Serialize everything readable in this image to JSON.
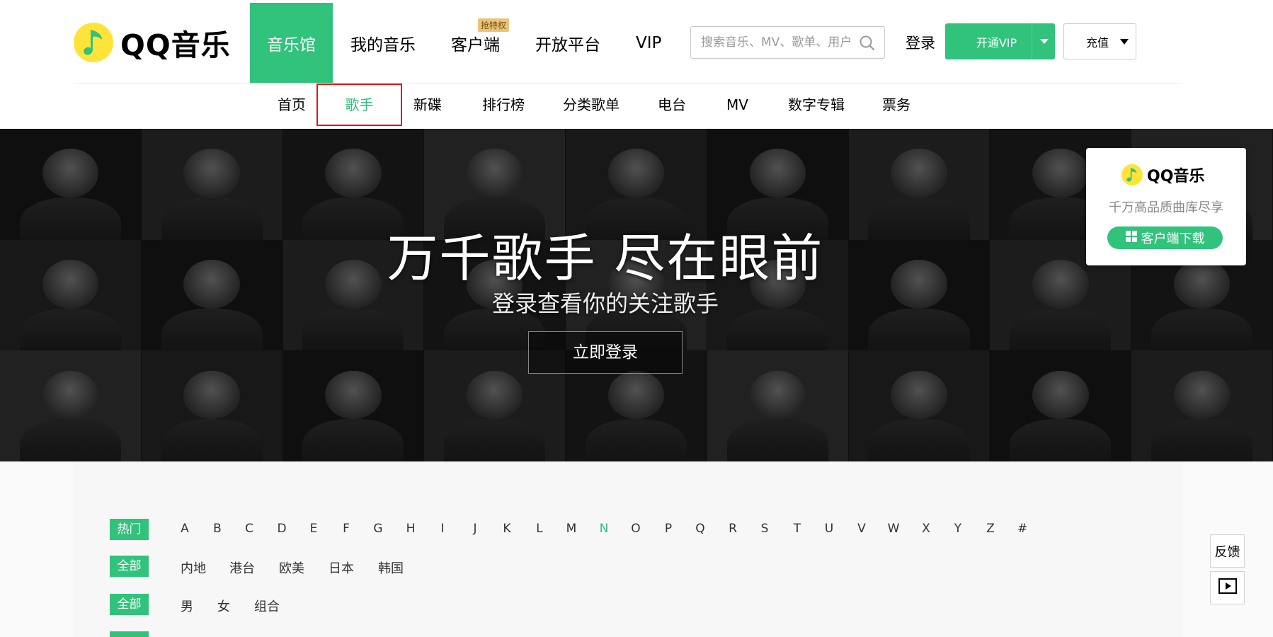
{
  "header": {
    "logo_text": "QQ音乐",
    "nav": [
      {
        "label": "音乐馆",
        "active": true
      },
      {
        "label": "我的音乐"
      },
      {
        "label": "客户端",
        "badge": "抢特权"
      },
      {
        "label": "开放平台"
      },
      {
        "label": "VIP"
      }
    ],
    "search_placeholder": "搜索音乐、MV、歌单、用户",
    "login": "登录",
    "vip_button": "开通VIP",
    "recharge_button": "充值"
  },
  "subnav": [
    "首页",
    "歌手",
    "新碟",
    "排行榜",
    "分类歌单",
    "电台",
    "MV",
    "数字专辑",
    "票务"
  ],
  "subnav_active": "歌手",
  "banner": {
    "title": "万千歌手 尽在眼前",
    "subtitle": "登录查看你的关注歌手",
    "button": "立即登录"
  },
  "download_card": {
    "logo_text": "QQ音乐",
    "slogan": "千万高品质曲库尽享",
    "button": "客户端下载"
  },
  "filters": {
    "index_tag": "热门",
    "letters": [
      "A",
      "B",
      "C",
      "D",
      "E",
      "F",
      "G",
      "H",
      "I",
      "J",
      "K",
      "L",
      "M",
      "N",
      "O",
      "P",
      "Q",
      "R",
      "S",
      "T",
      "U",
      "V",
      "W",
      "X",
      "Y",
      "Z",
      "#"
    ],
    "selected_letter": "N",
    "area_tag": "全部",
    "areas": [
      "内地",
      "港台",
      "欧美",
      "日本",
      "韩国"
    ],
    "sex_tag": "全部",
    "sexes": [
      "男",
      "女",
      "组合"
    ]
  },
  "side": {
    "feedback": "反馈",
    "play_icon": "play-icon"
  },
  "colors": {
    "brand_green": "#31c27c",
    "logo_yellow": "#ffe33a",
    "highlight_red": "#e0161b"
  }
}
